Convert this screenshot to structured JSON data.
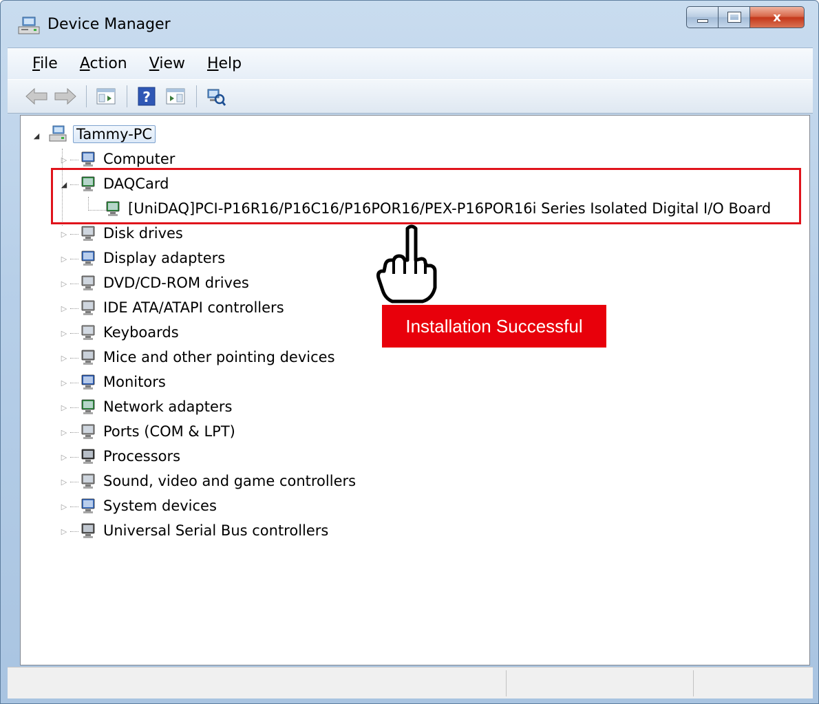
{
  "window": {
    "title": "Device Manager",
    "caption": {
      "minimize": "minimize",
      "maximize": "maximize",
      "close": "x"
    }
  },
  "menu": [
    {
      "accel": "F",
      "rest": "ile"
    },
    {
      "accel": "A",
      "rest": "ction"
    },
    {
      "accel": "V",
      "rest": "iew"
    },
    {
      "accel": "H",
      "rest": "elp"
    }
  ],
  "toolbar": {
    "icons": [
      "back-arrow-icon",
      "forward-arrow-icon",
      "show-hide-console-tree-icon",
      "help-icon",
      "action-pane-icon",
      "scan-hardware-changes-icon"
    ]
  },
  "tree": {
    "root": "Tammy-PC",
    "items": [
      {
        "label": "Computer",
        "icon": "computer-icon",
        "expanded": false
      },
      {
        "label": "DAQCard",
        "icon": "daqcard-icon",
        "expanded": true
      },
      {
        "label": "[UniDAQ]PCI-P16R16/P16C16/P16POR16/PEX-P16POR16i Series Isolated Digital I/O Board",
        "icon": "daq-board-icon",
        "child": true
      },
      {
        "label": "Disk drives",
        "icon": "disk-drive-icon",
        "expanded": false
      },
      {
        "label": "Display adapters",
        "icon": "display-adapter-icon",
        "expanded": false
      },
      {
        "label": "DVD/CD-ROM drives",
        "icon": "dvd-drive-icon",
        "expanded": false
      },
      {
        "label": "IDE ATA/ATAPI controllers",
        "icon": "ide-controller-icon",
        "expanded": false
      },
      {
        "label": "Keyboards",
        "icon": "keyboard-icon",
        "expanded": false
      },
      {
        "label": "Mice and other pointing devices",
        "icon": "mouse-icon",
        "expanded": false
      },
      {
        "label": "Monitors",
        "icon": "monitor-icon",
        "expanded": false
      },
      {
        "label": "Network adapters",
        "icon": "network-adapter-icon",
        "expanded": false
      },
      {
        "label": "Ports (COM & LPT)",
        "icon": "port-icon",
        "expanded": false
      },
      {
        "label": "Processors",
        "icon": "processor-icon",
        "expanded": false
      },
      {
        "label": "Sound, video and game controllers",
        "icon": "speaker-icon",
        "expanded": false
      },
      {
        "label": "System devices",
        "icon": "system-device-icon",
        "expanded": false
      },
      {
        "label": "Universal Serial Bus controllers",
        "icon": "usb-icon",
        "expanded": false
      }
    ]
  },
  "annotation": {
    "callout": "Installation Successful",
    "highlight_color": "#e0131b",
    "callout_color": "#e8000b"
  }
}
